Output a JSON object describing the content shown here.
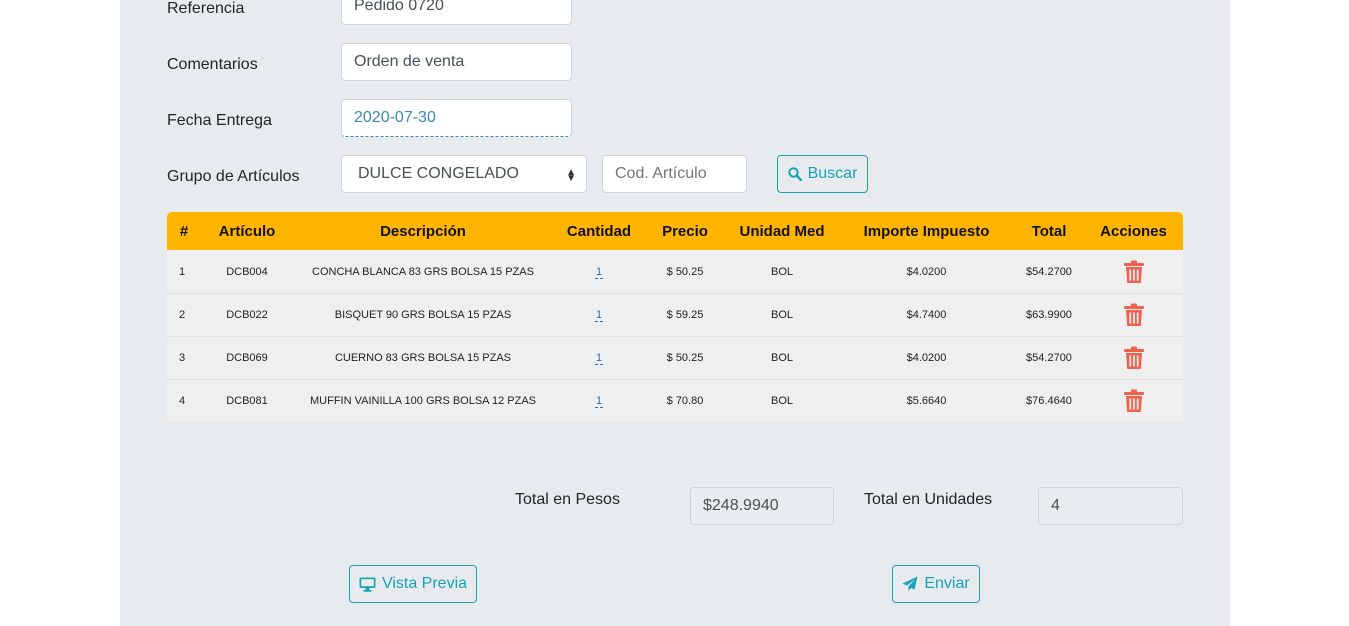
{
  "form": {
    "referencia": {
      "label": "Referencia",
      "value": "Pedido 0720"
    },
    "comentarios": {
      "label": "Comentarios",
      "value": "Orden de venta"
    },
    "fecha_entrega": {
      "label": "Fecha Entrega",
      "value": "2020-07-30"
    },
    "grupo": {
      "label": "Grupo de Artículos",
      "selected": "DULCE CONGELADO"
    },
    "cod_articulo": {
      "placeholder": "Cod. Artículo"
    },
    "buscar_label": "Buscar"
  },
  "table": {
    "headers": [
      "#",
      "Artículo",
      "Descripción",
      "Cantidad",
      "Precio",
      "Unidad Med",
      "Importe Impuesto",
      "Total",
      "Acciones"
    ],
    "rows": [
      {
        "n": "1",
        "articulo": "DCB004",
        "descripcion": "CONCHA BLANCA 83 GRS BOLSA 15 PZAS",
        "cantidad": "1",
        "precio": "$ 50.25",
        "unidad": "BOL",
        "impuesto": "$4.0200",
        "total": "$54.2700"
      },
      {
        "n": "2",
        "articulo": "DCB022",
        "descripcion": "BISQUET 90 GRS BOLSA 15 PZAS",
        "cantidad": "1",
        "precio": "$ 59.25",
        "unidad": "BOL",
        "impuesto": "$4.7400",
        "total": "$63.9900"
      },
      {
        "n": "3",
        "articulo": "DCB069",
        "descripcion": "CUERNO 83 GRS BOLSA 15 PZAS",
        "cantidad": "1",
        "precio": "$ 50.25",
        "unidad": "BOL",
        "impuesto": "$4.0200",
        "total": "$54.2700"
      },
      {
        "n": "4",
        "articulo": "DCB081",
        "descripcion": "MUFFIN VAINILLA 100 GRS BOLSA 12 PZAS",
        "cantidad": "1",
        "precio": "$ 70.80",
        "unidad": "BOL",
        "impuesto": "$5.6640",
        "total": "$76.4640"
      }
    ]
  },
  "totals": {
    "pesos_label": "Total en Pesos",
    "pesos_value": "$248.9940",
    "unidades_label": "Total en Unidades",
    "unidades_value": "4"
  },
  "actions": {
    "vista_previa": "Vista Previa",
    "enviar": "Enviar"
  },
  "colors": {
    "header": "#ffb500",
    "accent": "#17a2b8",
    "trash": "#f0624d",
    "panel": "#e8ebee"
  }
}
